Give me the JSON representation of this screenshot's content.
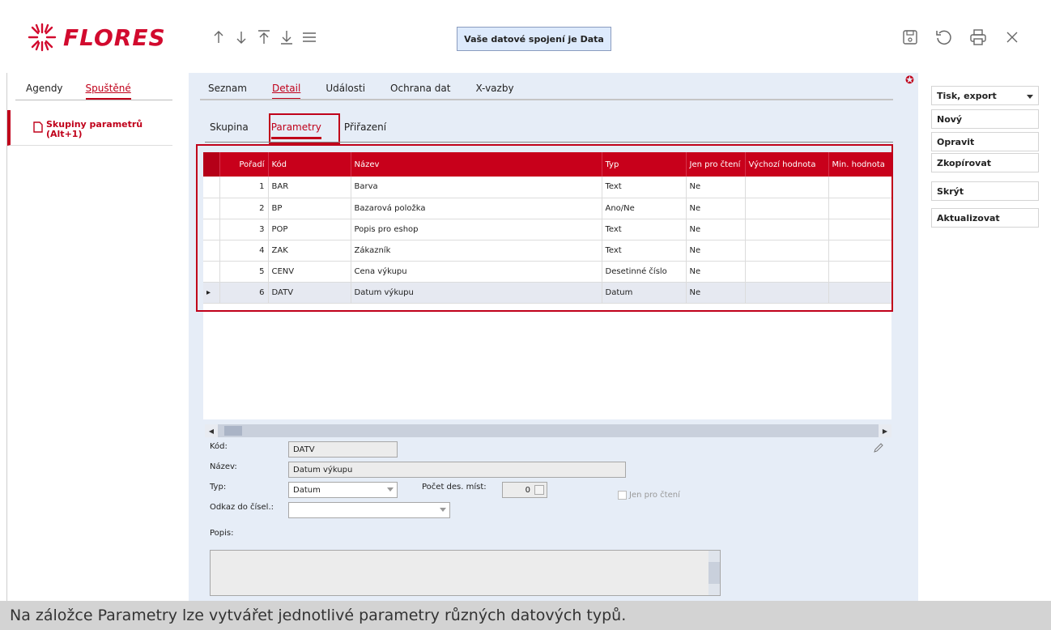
{
  "header": {
    "logo_text": "FLORES",
    "connection_label": "Vaše datové spojení je Data",
    "nav_icons": [
      "arrow-up-icon",
      "arrow-down-icon",
      "arrow-to-top-icon",
      "arrow-to-bottom-icon",
      "menu-icon"
    ],
    "right_icons": [
      "save-icon",
      "refresh-icon",
      "print-icon",
      "close-icon"
    ]
  },
  "left": {
    "tabs": [
      {
        "label": "Agendy"
      },
      {
        "label": "Spuštěné"
      }
    ],
    "item_line1": "Skupiny parametrů",
    "item_line2": "(Alt+1)"
  },
  "main": {
    "tabs": [
      {
        "label": "Seznam"
      },
      {
        "label": "Detail"
      },
      {
        "label": "Události"
      },
      {
        "label": "Ochrana dat"
      },
      {
        "label": "X-vazby"
      }
    ],
    "subtabs": [
      {
        "label": "Skupina"
      },
      {
        "label": "Parametry"
      },
      {
        "label": "Přiřazení"
      }
    ]
  },
  "grid": {
    "columns": [
      "Pořadí",
      "Kód",
      "Název",
      "Typ",
      "Jen pro čtení",
      "Výchozí hodnota",
      "Min. hodnota"
    ],
    "rows": [
      {
        "poradi": "1",
        "kod": "BAR",
        "nazev": "Barva",
        "typ": "Text",
        "jen": "Ne",
        "vychozi": "",
        "min": ""
      },
      {
        "poradi": "2",
        "kod": "BP",
        "nazev": "Bazarová položka",
        "typ": "Ano/Ne",
        "jen": "Ne",
        "vychozi": "",
        "min": ""
      },
      {
        "poradi": "3",
        "kod": "POP",
        "nazev": "Popis pro eshop",
        "typ": "Text",
        "jen": "Ne",
        "vychozi": "",
        "min": ""
      },
      {
        "poradi": "4",
        "kod": "ZAK",
        "nazev": "Zákazník",
        "typ": "Text",
        "jen": "Ne",
        "vychozi": "",
        "min": ""
      },
      {
        "poradi": "5",
        "kod": "CENV",
        "nazev": "Cena výkupu",
        "typ": "Desetinné číslo",
        "jen": "Ne",
        "vychozi": "",
        "min": ""
      },
      {
        "poradi": "6",
        "kod": "DATV",
        "nazev": "Datum výkupu",
        "typ": "Datum",
        "jen": "Ne",
        "vychozi": "",
        "min": ""
      }
    ],
    "selected_row": 5
  },
  "form": {
    "kod_label": "Kód:",
    "kod_value": "DATV",
    "nazev_label": "Název:",
    "nazev_value": "Datum výkupu",
    "typ_label": "Typ:",
    "typ_value": "Datum",
    "pocet_label": "Počet des. míst:",
    "pocet_value": "0",
    "jen_label": "Jen pro čtení",
    "odkaz_label": "Odkaz do čísel.:",
    "odkaz_value": "",
    "popis_label": "Popis:",
    "popis_value": ""
  },
  "actions": {
    "tisk": "Tisk, export",
    "novy": "Nový",
    "opravit": "Opravit",
    "zkopirovat": "Zkopírovat",
    "skryt": "Skrýt",
    "aktualizovat": "Aktualizovat"
  },
  "caption": "Na záložce Parametry lze vytvářet jednotlivé parametry různých datových typů.",
  "colors": {
    "accent": "#c0001a",
    "header_row": "#c8001b",
    "panel_bg": "#e6edf7"
  }
}
